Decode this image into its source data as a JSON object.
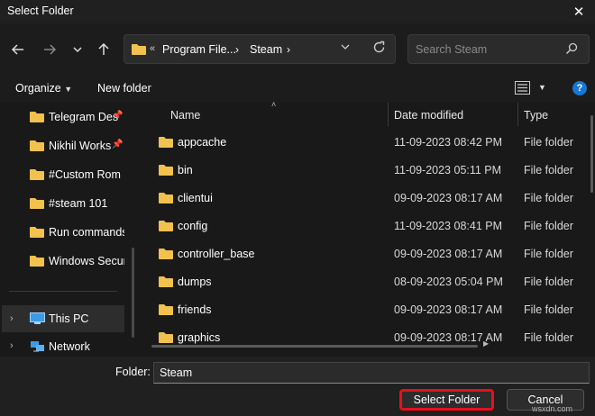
{
  "window": {
    "title": "Select Folder"
  },
  "address": {
    "crumbs": [
      "Program File...",
      "Steam"
    ]
  },
  "search": {
    "placeholder": "Search Steam"
  },
  "toolbar": {
    "organize_label": "Organize",
    "new_folder_label": "New folder"
  },
  "sidebar": {
    "items": [
      {
        "label": "Telegram Des",
        "pinned": true
      },
      {
        "label": "Nikhil Works",
        "pinned": true
      },
      {
        "label": "#Custom Rom",
        "pinned": false
      },
      {
        "label": "#steam 101",
        "pinned": false
      },
      {
        "label": "Run commands",
        "pinned": false
      },
      {
        "label": "Windows Securi",
        "pinned": false
      }
    ],
    "tree": [
      {
        "label": "This PC",
        "selected": true
      },
      {
        "label": "Network",
        "selected": false
      }
    ]
  },
  "columns": {
    "name": "Name",
    "date": "Date modified",
    "type": "Type"
  },
  "files": [
    {
      "name": "appcache",
      "date": "11-09-2023 08:42 PM",
      "type": "File folder"
    },
    {
      "name": "bin",
      "date": "11-09-2023 05:11 PM",
      "type": "File folder"
    },
    {
      "name": "clientui",
      "date": "09-09-2023 08:17 AM",
      "type": "File folder"
    },
    {
      "name": "config",
      "date": "11-09-2023 08:41 PM",
      "type": "File folder"
    },
    {
      "name": "controller_base",
      "date": "09-09-2023 08:17 AM",
      "type": "File folder"
    },
    {
      "name": "dumps",
      "date": "08-09-2023 05:04 PM",
      "type": "File folder"
    },
    {
      "name": "friends",
      "date": "09-09-2023 08:17 AM",
      "type": "File folder"
    },
    {
      "name": "graphics",
      "date": "09-09-2023 08:17 AM",
      "type": "File folder"
    }
  ],
  "footer": {
    "folder_label": "Folder:",
    "folder_value": "Steam",
    "select_label": "Select Folder",
    "cancel_label": "Cancel"
  },
  "watermark": "wsxdn.com",
  "colors": {
    "background": "#191919",
    "highlight": "#e5101d",
    "folder": "#f2c14e",
    "help": "#1976d2"
  }
}
